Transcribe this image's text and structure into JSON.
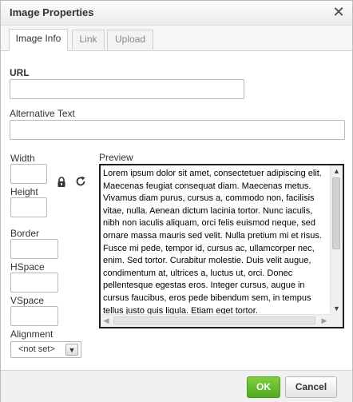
{
  "dialog": {
    "title": "Image Properties",
    "close_icon": "close-icon"
  },
  "tabs": [
    {
      "label": "Image Info",
      "active": true
    },
    {
      "label": "Link",
      "active": false
    },
    {
      "label": "Upload",
      "active": false
    }
  ],
  "fields": {
    "url_label": "URL",
    "url_value": "",
    "alt_label": "Alternative Text",
    "alt_value": "",
    "width_label": "Width",
    "height_label": "Height",
    "border_label": "Border",
    "hspace_label": "HSpace",
    "vspace_label": "VSpace",
    "alignment_label": "Alignment",
    "alignment_value": "<not set>",
    "lock_icon": "lock-icon",
    "reset_icon": "reset-size-icon"
  },
  "preview": {
    "label": "Preview",
    "text": "Lorem ipsum dolor sit amet, consectetuer adipiscing elit. Maecenas feugiat consequat diam. Maecenas metus. Vivamus diam purus, cursus a, commodo non, facilisis vitae, nulla. Aenean dictum lacinia tortor. Nunc iaculis, nibh non iaculis aliquam, orci felis euismod neque, sed ornare massa mauris sed velit. Nulla pretium mi et risus. Fusce mi pede, tempor id, cursus ac, ullamcorper nec, enim. Sed tortor. Curabitur molestie. Duis velit augue, condimentum at, ultrices a, luctus ut, orci. Donec pellentesque egestas eros. Integer cursus, augue in cursus faucibus, eros pede bibendum sem, in tempus tellus justo quis ligula. Etiam eget tortor."
  },
  "footer": {
    "ok_label": "OK",
    "cancel_label": "Cancel"
  },
  "colors": {
    "ok_button": "#5cb82a",
    "preview_border": "#1f1f1f"
  }
}
